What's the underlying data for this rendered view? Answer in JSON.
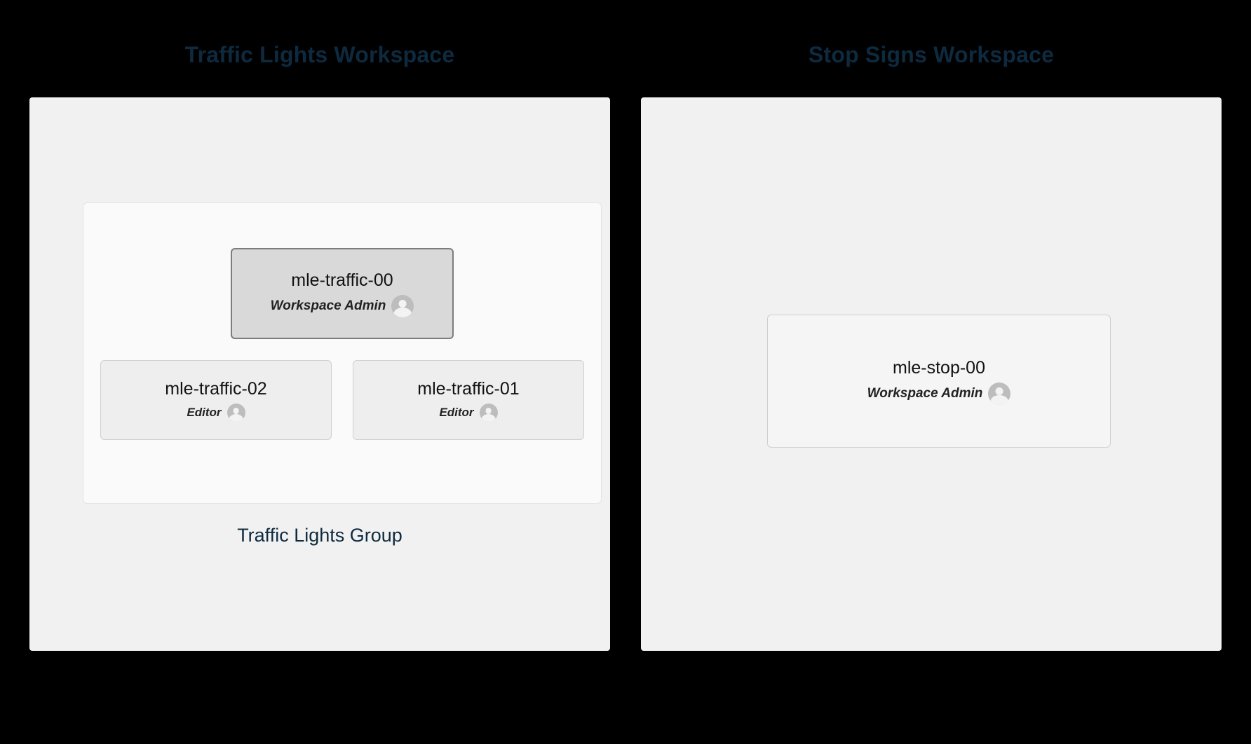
{
  "left": {
    "title": "Traffic Lights Workspace",
    "group_label": "Traffic Lights Group",
    "admin": {
      "name": "mle-traffic-00",
      "role": "Workspace Admin"
    },
    "editors": [
      {
        "name": "mle-traffic-02",
        "role": "Editor"
      },
      {
        "name": "mle-traffic-01",
        "role": "Editor"
      }
    ]
  },
  "right": {
    "title": "Stop Signs Workspace",
    "admin": {
      "name": "mle-stop-00",
      "role": "Workspace Admin"
    }
  }
}
